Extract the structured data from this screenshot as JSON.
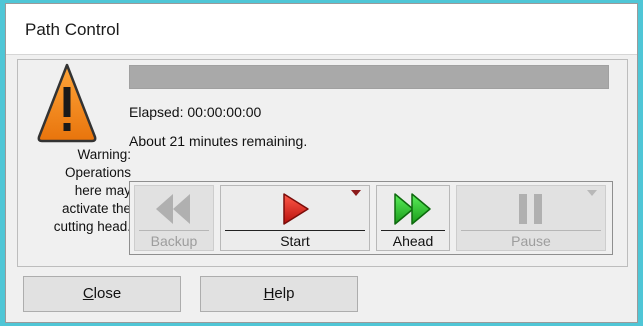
{
  "window": {
    "title": "Path Control"
  },
  "warning": {
    "icon": "warning-triangle-icon",
    "lines": [
      "Warning:",
      "Operations",
      "here may",
      "activate the",
      "cutting head."
    ]
  },
  "progress": {
    "fraction": 0
  },
  "status": {
    "elapsed": "Elapsed: 00:00:00:00",
    "remaining": "About 21 minutes remaining."
  },
  "toolbar": {
    "backup": {
      "label": "Backup",
      "icon": "rewind-icon",
      "enabled": false
    },
    "start": {
      "label": "Start",
      "icon": "play-icon",
      "enabled": true,
      "color": "#e0281e"
    },
    "ahead": {
      "label": "Ahead",
      "icon": "fast-forward-icon",
      "enabled": true,
      "color": "#2fbf2f"
    },
    "pause": {
      "label": "Pause",
      "icon": "pause-icon",
      "enabled": false
    }
  },
  "buttons": {
    "close": {
      "mnemonic": "C",
      "rest": "lose"
    },
    "help": {
      "mnemonic": "H",
      "rest": "elp"
    }
  }
}
